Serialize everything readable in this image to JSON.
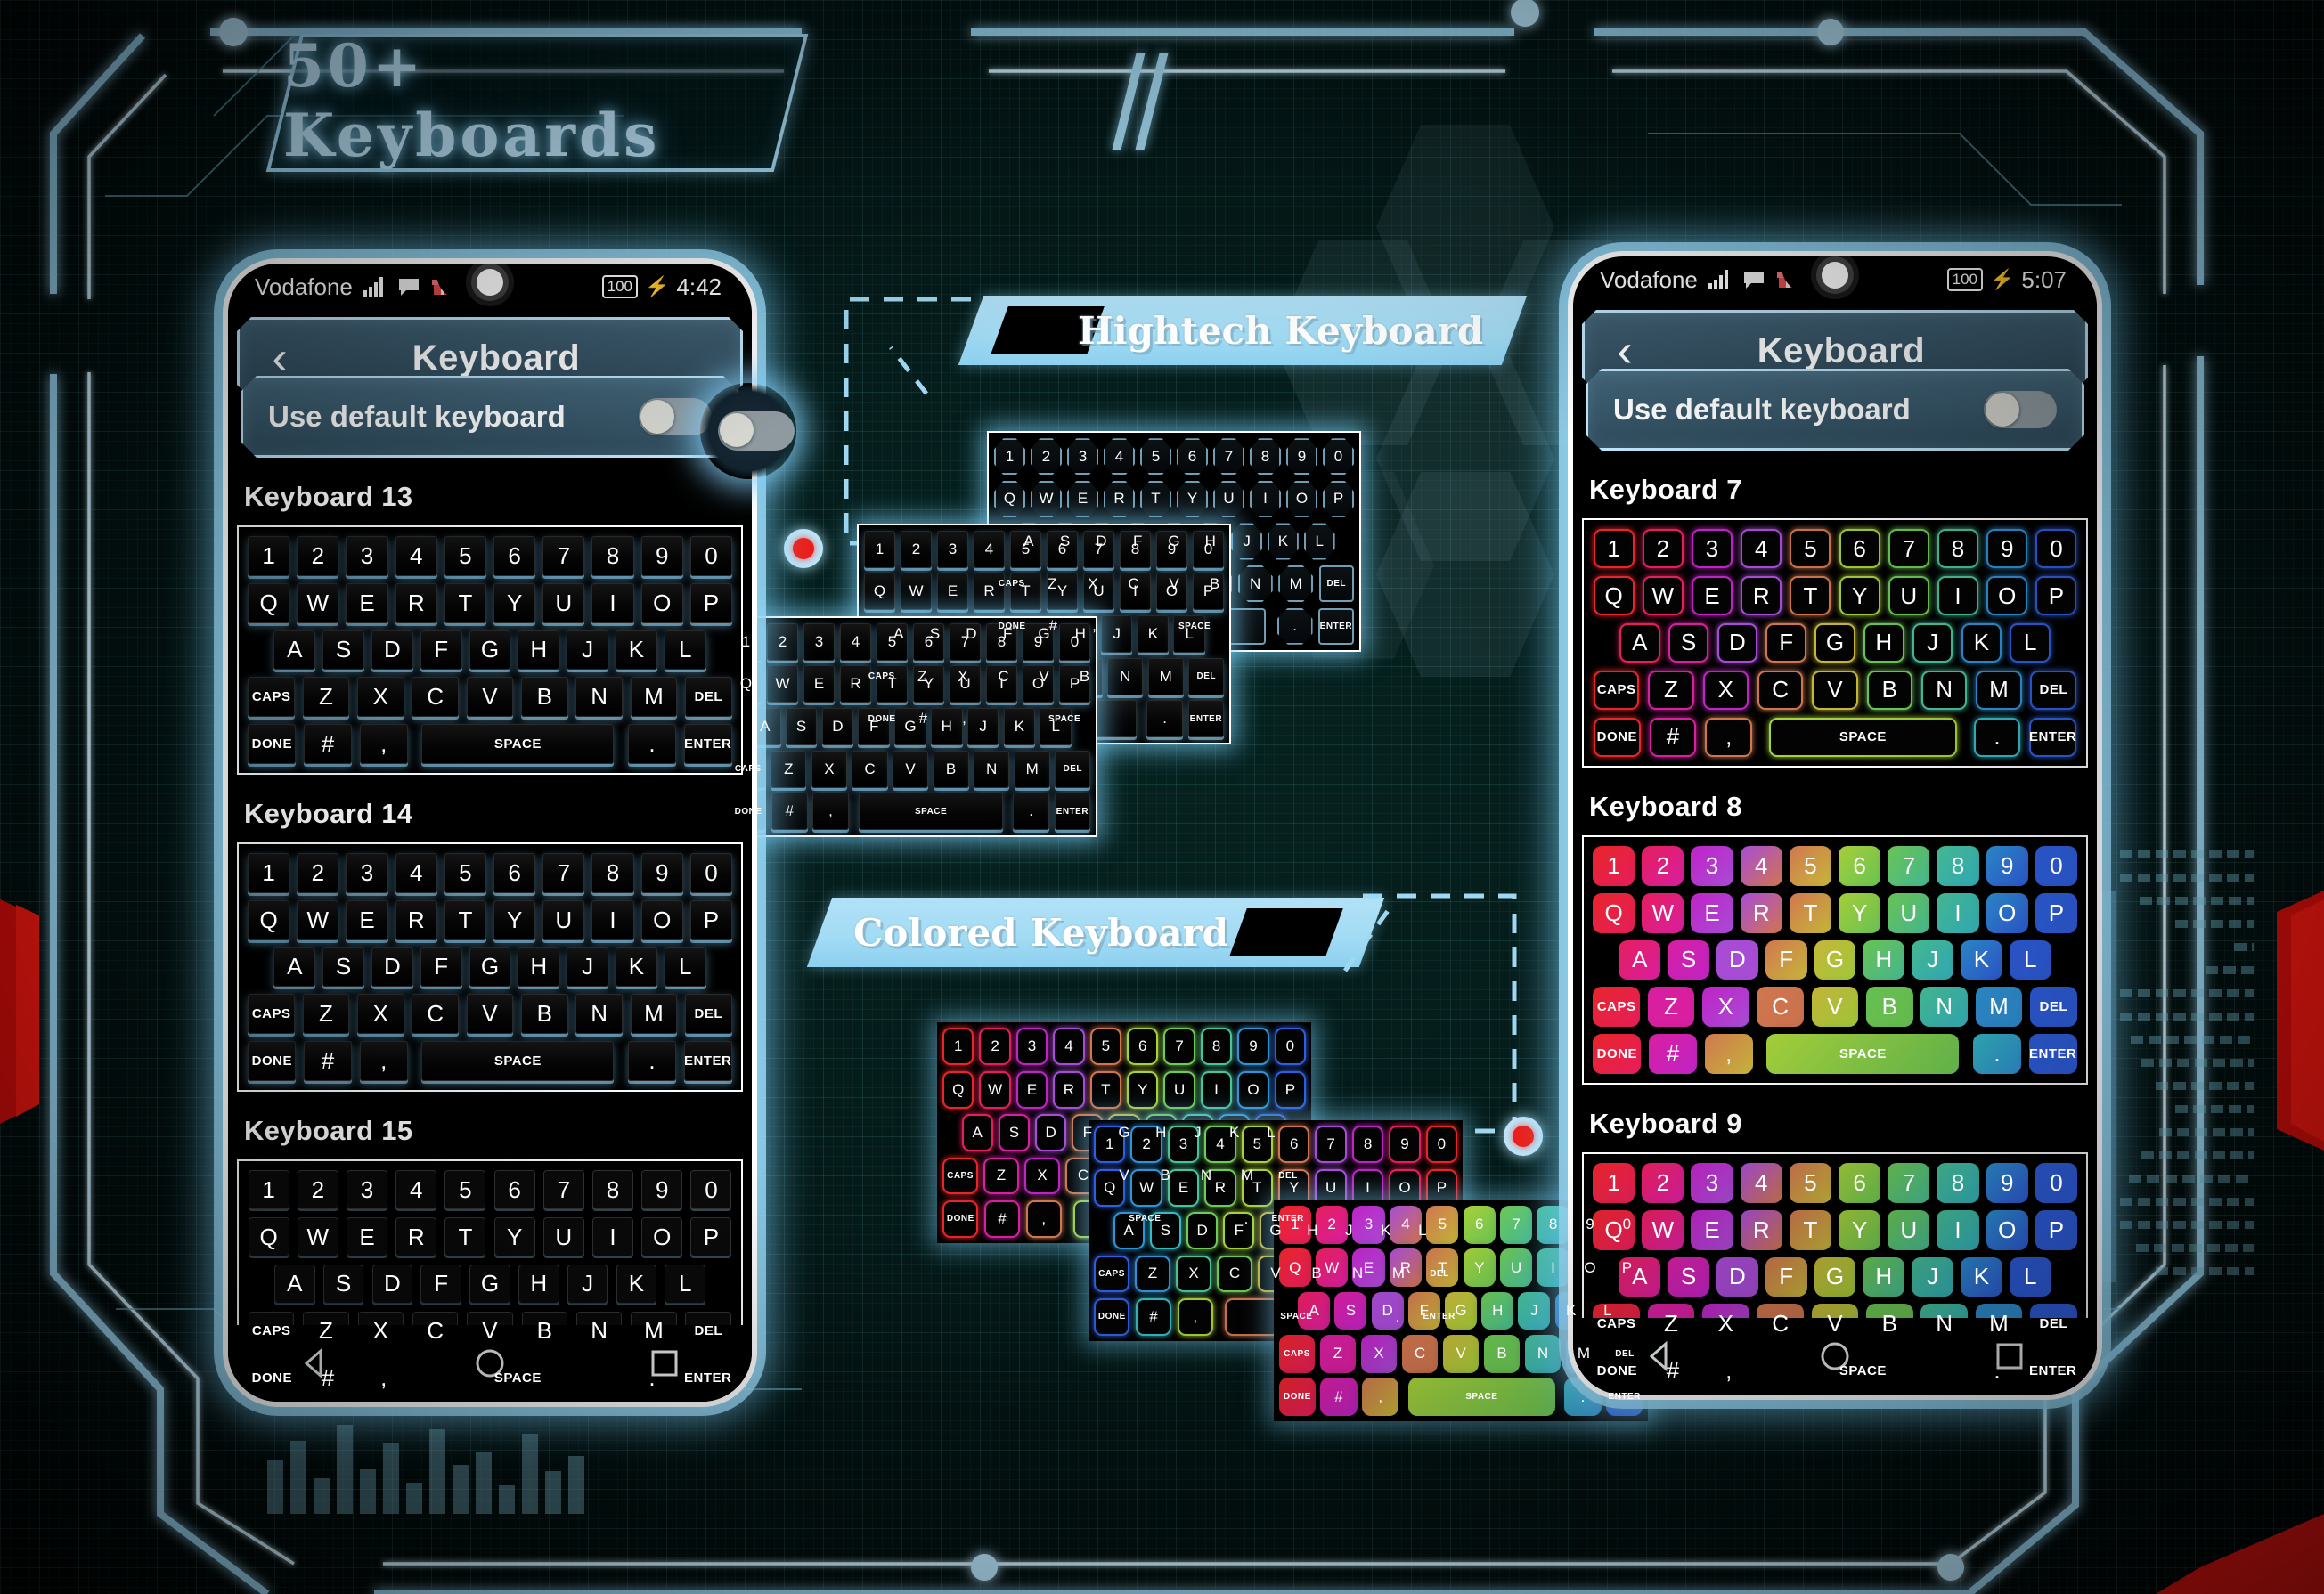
{
  "page": {
    "title": "50+ Keyboards",
    "accent_blue": "#a7dcf4",
    "accent_red": "#ed1c16",
    "background": "#041a19"
  },
  "banners": [
    {
      "label": "Hightech Keyboard"
    },
    {
      "label": "Colored Keyboard"
    }
  ],
  "phones": [
    {
      "id": "left",
      "status": {
        "carrier": "Vodafone",
        "battery": "100",
        "charging": "⚡",
        "time": "4:42"
      },
      "appbar": {
        "back": "‹",
        "title": "Keyboard"
      },
      "setting": {
        "label": "Use default keyboard",
        "toggle_state": "off"
      },
      "sections": [
        {
          "label": "Keyboard 13",
          "theme": "gloss"
        },
        {
          "label": "Keyboard 14",
          "theme": "gloss"
        },
        {
          "label": "Keyboard 15",
          "theme": "flat"
        }
      ],
      "nav": {
        "back": "back-triangle",
        "home": "home-circle",
        "recents": "recents-square"
      }
    },
    {
      "id": "right",
      "status": {
        "carrier": "Vodafone",
        "battery": "100",
        "charging": "⚡",
        "time": "5:07"
      },
      "appbar": {
        "back": "‹",
        "title": "Keyboard"
      },
      "setting": {
        "label": "Use default keyboard",
        "toggle_state": "off"
      },
      "sections": [
        {
          "label": "Keyboard 7",
          "theme": "outline"
        },
        {
          "label": "Keyboard 8",
          "theme": "solid"
        },
        {
          "label": "Keyboard 9",
          "theme": "solid"
        }
      ],
      "nav": {
        "back": "back-triangle",
        "home": "home-circle",
        "recents": "recents-square"
      }
    }
  ],
  "keyboard_layout": {
    "rows": [
      [
        "1",
        "2",
        "3",
        "4",
        "5",
        "6",
        "7",
        "8",
        "9",
        "0"
      ],
      [
        "Q",
        "W",
        "E",
        "R",
        "T",
        "Y",
        "U",
        "I",
        "O",
        "P"
      ],
      [
        "A",
        "S",
        "D",
        "F",
        "G",
        "H",
        "J",
        "K",
        "L"
      ],
      [
        "CAPS",
        "Z",
        "X",
        "C",
        "V",
        "B",
        "N",
        "M",
        "DEL"
      ],
      [
        "DONE",
        "#",
        ",",
        "SPACE",
        ".",
        "ENTER"
      ]
    ],
    "row_indent": [
      0,
      0,
      0.5,
      0,
      0
    ],
    "wide_keys": [
      "CAPS",
      "DEL",
      "DONE",
      "SPACE",
      "ENTER"
    ],
    "space_flex": 4
  },
  "key_colors": {
    "rainbow": [
      "#e8252a",
      "#e61e5c",
      "#d81fa0",
      "#c023c6",
      "#a84cd6",
      "#d0764f",
      "#c9b93a",
      "#a8d13a",
      "#6ecb55",
      "#49c49a",
      "#35b9c4",
      "#2f93d8",
      "#2f5fe0"
    ],
    "solid_row_start": [
      "#e8252a",
      "#e8252a",
      "#e6187a",
      "#e6187a",
      "#e6187a",
      "#e6187a"
    ]
  },
  "labels": {
    "space": "SPACE",
    "caps": "CAPS",
    "del": "DEL",
    "done": "DONE",
    "enter": "ENTER",
    "hash": "#",
    "comma": ",",
    "period": "."
  }
}
